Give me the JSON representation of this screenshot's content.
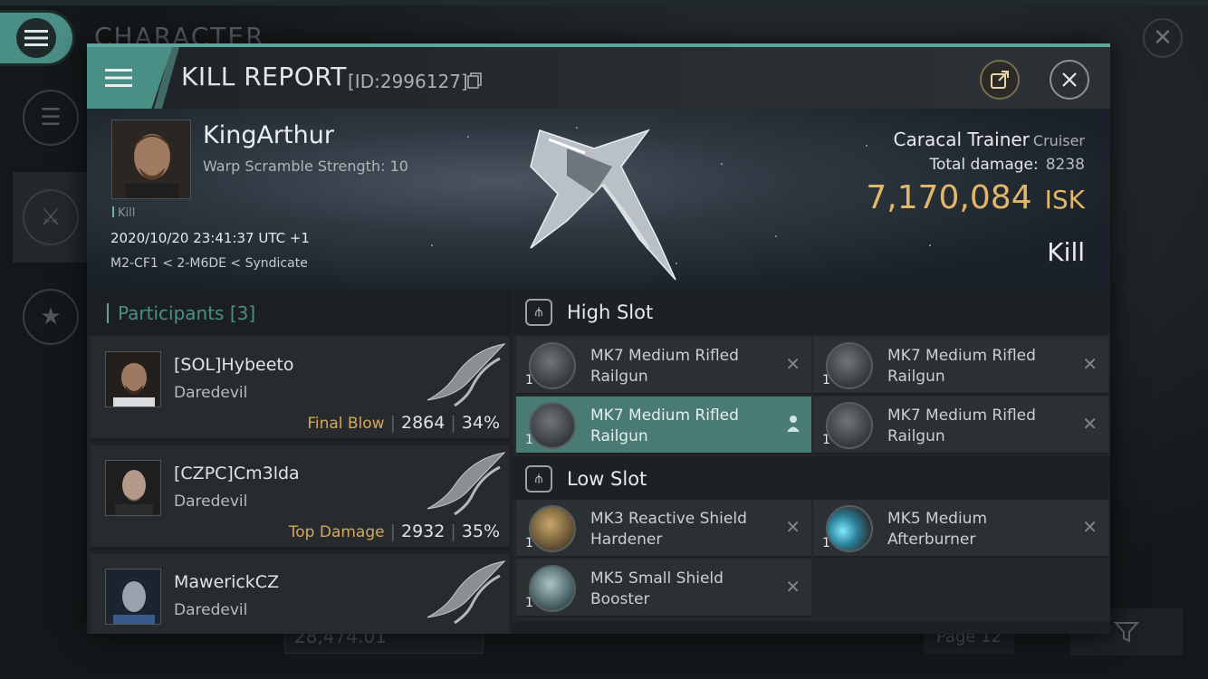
{
  "background": {
    "title": "CHARACTER",
    "wallet": "28,474.01",
    "page": "Page 12"
  },
  "modal": {
    "title": "KILL REPORT",
    "id": "[ID:2996127]"
  },
  "victim": {
    "name": "KingArthur",
    "subtitle": "Warp Scramble Strength: 10",
    "kill_tag": "Kill",
    "time": "2020/10/20 23:41:37 UTC +1",
    "location": "M2-CF1 < 2-M6DE < Syndicate",
    "ship": "Caracal Trainer",
    "ship_class": "Cruiser",
    "total_damage_label": "Total damage:",
    "total_damage": "8238",
    "isk_value": "7,170,084",
    "isk_unit": "ISK",
    "result_label": "Kill"
  },
  "participants": {
    "header": "Participants",
    "count": "[3]",
    "items": [
      {
        "name": "[SOL]Hybeeto",
        "ship": "Daredevil",
        "tag": "Final Blow",
        "damage": "2864",
        "percent": "34%"
      },
      {
        "name": "[CZPC]Cm3lda",
        "ship": "Daredevil",
        "tag": "Top Damage",
        "damage": "2932",
        "percent": "35%"
      },
      {
        "name": "MawerickCZ",
        "ship": "Daredevil",
        "tag": "",
        "damage": "",
        "percent": ""
      }
    ]
  },
  "fitting": {
    "high_slot_label": "High Slot",
    "low_slot_label": "Low Slot",
    "high": [
      {
        "name": "MK7 Medium Rifled Railgun",
        "qty": "1"
      },
      {
        "name": "MK7 Medium Rifled Railgun",
        "qty": "1"
      },
      {
        "name": "MK7 Medium Rifled Railgun",
        "qty": "1"
      },
      {
        "name": "MK7 Medium Rifled Railgun",
        "qty": "1"
      }
    ],
    "low": [
      {
        "name": "MK3 Reactive Shield Hardener",
        "qty": "1"
      },
      {
        "name": "MK5 Medium Afterburner",
        "qty": "1"
      },
      {
        "name": "MK5 Small Shield Booster",
        "qty": "1"
      }
    ]
  },
  "colors": {
    "accent": "#5fa69a",
    "isk": "#e2b76a",
    "tag": "#d3a85a"
  }
}
